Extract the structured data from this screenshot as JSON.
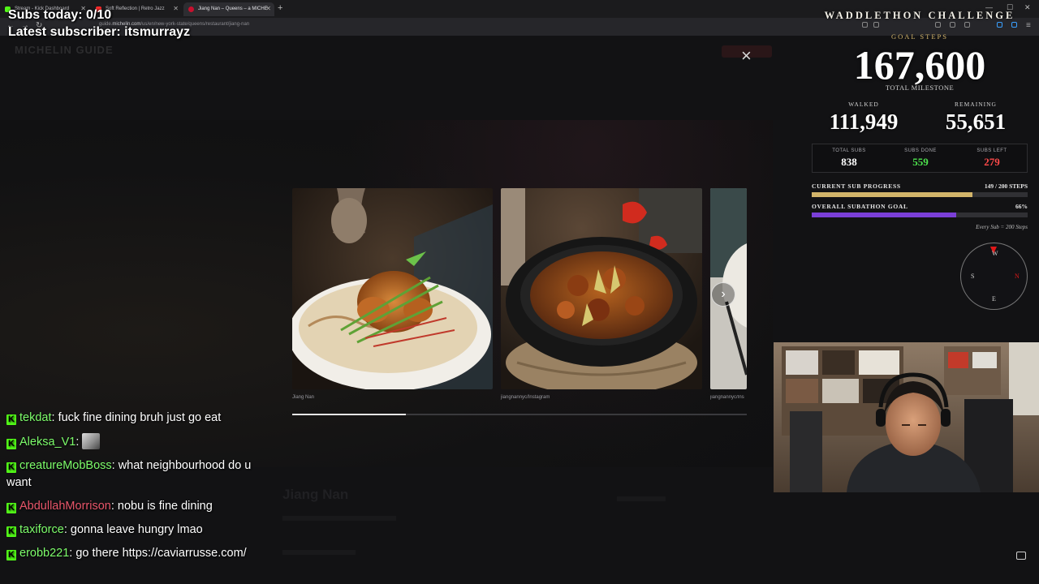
{
  "browser": {
    "tabs": [
      {
        "title": "Stream - Kick Dashboard",
        "favicon_color": "#53fc18"
      },
      {
        "title": "Soft Reflection | Retro Jazz",
        "favicon_color": "#ff2b2b"
      },
      {
        "title": "Jiang Nan – Queens – a MICHE",
        "favicon_color": "#c8102e"
      }
    ],
    "new_tab_glyph": "+",
    "url_prefix": "guide.",
    "url_domain": "michelin.com",
    "url_path": "/us/en/new-york-state/queens/restaurant/jiang-nan"
  },
  "site": {
    "logo": "MICHELIN GUIDE",
    "restaurant_name": "Jiang Nan"
  },
  "gallery": {
    "close_glyph": "×",
    "next_glyph": "›",
    "captions": [
      "Jiang Nan",
      "jiangnannyc/Instagram",
      "jiangnannyc/Ins"
    ],
    "progress_fraction": 0.25
  },
  "overlay": {
    "subs_today": "Subs today: 0/10",
    "latest_subscriber": "Latest subscriber: itsmurrayz"
  },
  "chat": {
    "badge_glyph": "K",
    "messages": [
      {
        "user": "tekdat",
        "color": "#7cfc6a",
        "text": "fuck fine dining bruh just go eat"
      },
      {
        "user": "Aleksa_V1",
        "color": "#7cfc6a",
        "text": "",
        "emote": true
      },
      {
        "user": "creatureMobBoss",
        "color": "#7cfc6a",
        "text": "what neighbourhood do u want"
      },
      {
        "user": "AbdullahMorrison",
        "color": "#e8566a",
        "text": "nobu is fine dining"
      },
      {
        "user": "taxiforce",
        "color": "#7cfc6a",
        "text": "gonna leave hungry lmao"
      },
      {
        "user": "erobb221",
        "color": "#7cfc6a",
        "text": "go there https://caviarrusse.com/"
      }
    ]
  },
  "waddlethon": {
    "title": "WADDLETHON CHALLENGE",
    "goal_label": "GOAL STEPS",
    "goal_steps": "167,600",
    "milestone_label": "TOTAL MILESTONE",
    "walked_label": "WALKED",
    "walked": "111,949",
    "remaining_label": "REMAINING",
    "remaining": "55,651",
    "subs": {
      "total_label": "TOTAL SUBS",
      "total": "838",
      "done_label": "SUBS DONE",
      "done": "559",
      "left_label": "SUBS LEFT",
      "left": "279"
    },
    "current_progress_label": "CURRENT SUB PROGRESS",
    "current_progress_value": "149 / 200 STEPS",
    "current_progress_fraction": 0.745,
    "overall_label": "OVERALL SUBATHON GOAL",
    "overall_value": "66%",
    "overall_fraction": 0.67,
    "note": "Every Sub = 200 Steps",
    "colors": {
      "gold": "#d2b46a",
      "green": "#4ee54e",
      "red": "#ff4a4a",
      "purple": "#7b3fd8"
    }
  },
  "compass": {
    "n": "W",
    "s": "E",
    "w": "S",
    "e": "N"
  }
}
